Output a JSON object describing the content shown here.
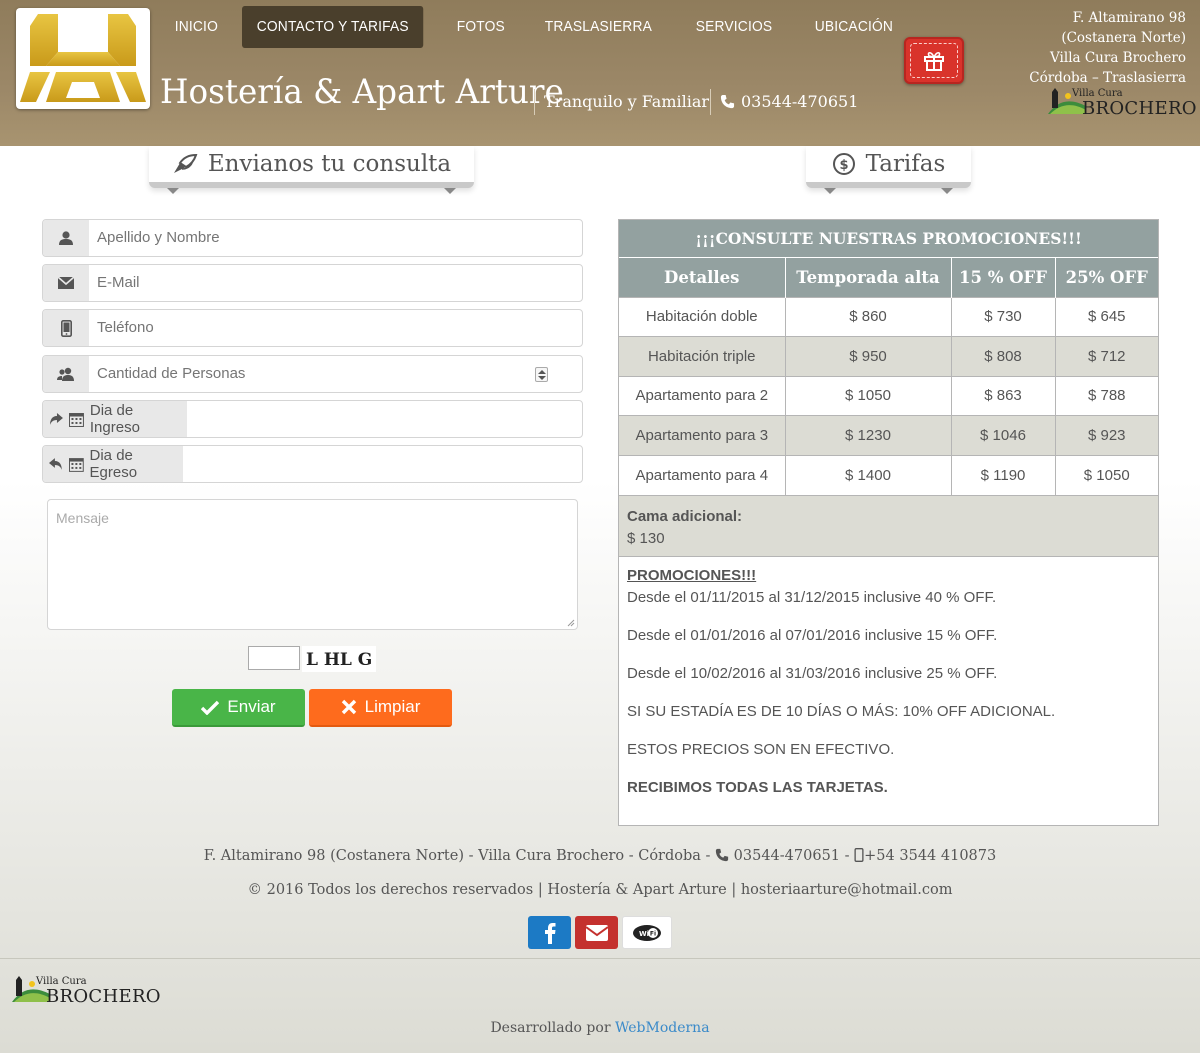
{
  "header": {
    "nav": [
      {
        "label": "INICIO"
      },
      {
        "label": "CONTACTO Y TARIFAS"
      },
      {
        "label": "FOTOS"
      },
      {
        "label": "TRASLASIERRA"
      },
      {
        "label": "SERVICIOS"
      },
      {
        "label": "UBICACIÓN"
      }
    ],
    "title": "Hostería & Apart Arture",
    "tagline": "Tranquilo y Familiar",
    "phone": "03544-470651",
    "address": [
      "F. Altamirano 98",
      "(Costanera Norte)",
      "Villa Cura Brochero",
      "Córdoba – Traslasierra"
    ],
    "town_logo_small": "Villa Cura",
    "town_logo_big": "BROCHERO"
  },
  "contact": {
    "title": "Envianos tu consulta",
    "fields": {
      "name_placeholder": "Apellido y Nombre",
      "email_placeholder": "E-Mail",
      "phone_placeholder": "Teléfono",
      "people_placeholder": "Cantidad de Personas",
      "checkin_label": "Dia de Ingreso",
      "checkout_label": "Dia de Egreso",
      "message_placeholder": "Mensaje"
    },
    "captcha_text": "L HL G",
    "send_label": "Enviar",
    "clear_label": "Limpiar"
  },
  "rates": {
    "title": "Tarifas",
    "banner": "¡¡¡CONSULTE NUESTRAS PROMOCIONES!!!",
    "headers": [
      "Detalles",
      "Temporada alta",
      "15 % OFF",
      "25% OFF"
    ],
    "rows": [
      [
        "Habitación doble",
        "$ 860",
        "$ 730",
        "$ 645"
      ],
      [
        "Habitación triple",
        "$ 950",
        "$ 808",
        "$ 712"
      ],
      [
        "Apartamento para 2",
        "$ 1050",
        "$ 863",
        "$ 788"
      ],
      [
        "Apartamento para 3",
        "$ 1230",
        "$ 1046",
        "$ 923"
      ],
      [
        "Apartamento para 4",
        "$ 1400",
        "$ 1190",
        "$ 1050"
      ]
    ],
    "extra_bed_label": "Cama adicional:",
    "extra_bed_price": "$ 130",
    "promos_title": "PROMOCIONES!!!",
    "promos": [
      "Desde el 01/11/2015 al 31/12/2015 inclusive 40 % OFF.",
      "Desde el 01/01/2016 al 07/01/2016 inclusive 15 % OFF.",
      "Desde el 10/02/2016 al 31/03/2016 inclusive 25 % OFF.",
      "SI SU ESTADÍA ES DE 10 DÍAS O MÁS: 10% OFF ADICIONAL.",
      "ESTOS PRECIOS SON EN EFECTIVO."
    ],
    "cards_note": "RECIBIMOS TODAS LAS TARJETAS."
  },
  "footer": {
    "address_line": "F. Altamirano 98 (Costanera Norte) - Villa Cura Brochero - Córdoba -",
    "phone": "03544-470651 -",
    "mobile": "+54 3544 410873",
    "copyright": "© 2016 Todos los derechos reservados | Hostería & Apart Arture | hosteriaarture@hotmail.com",
    "dev_prefix": "Desarrollado por",
    "dev_name": "WebModerna"
  },
  "colors": {
    "header_brown": "#9c8868",
    "nav_active": "#4a3f2c",
    "table_header": "#93a1a0",
    "row_alt": "#dcdcd4",
    "send_green": "#49b548",
    "clear_orange": "#fe6b1d",
    "gift_red": "#d9332b",
    "facebook_blue": "#1c7ac5",
    "email_red": "#c4312e"
  }
}
